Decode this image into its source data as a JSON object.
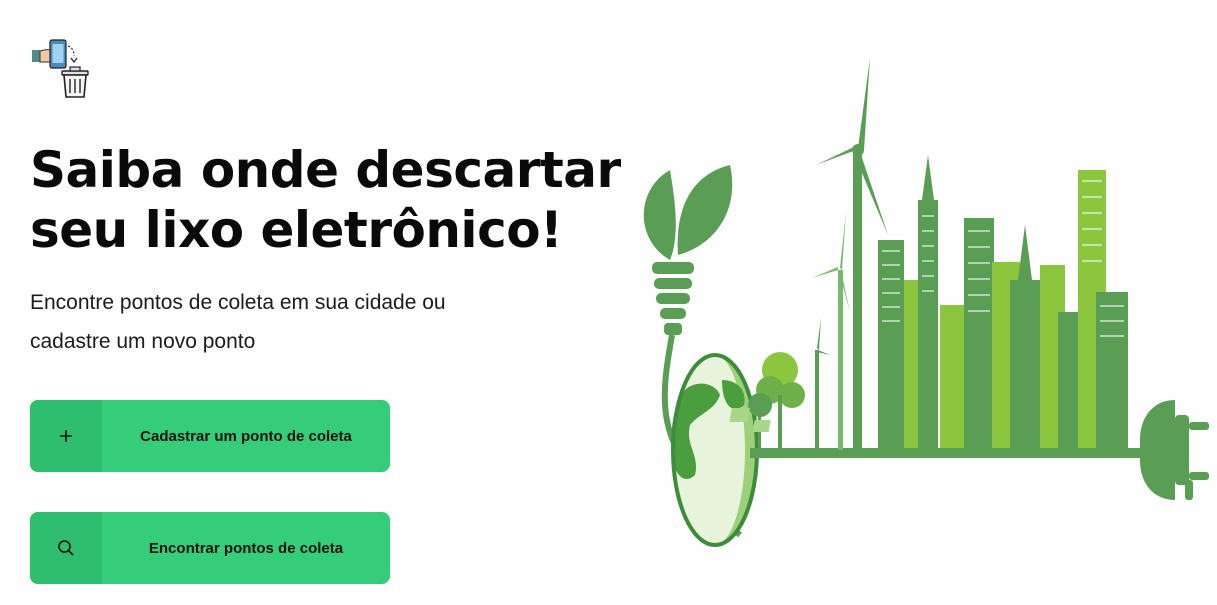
{
  "header": {
    "logo_icon": "recycle-phone-trash-icon"
  },
  "hero": {
    "title_line1": "Saiba onde descartar",
    "title_line2": "seu lixo eletrônico!",
    "subtitle_line1": "Encontre pontos de coleta em sua cidade ou",
    "subtitle_line2": "cadastre um novo ponto"
  },
  "actions": {
    "register": {
      "label": "Cadastrar um ponto de coleta",
      "icon": "plus-icon"
    },
    "find": {
      "label": "Encontrar pontos de coleta",
      "icon": "search-icon"
    }
  },
  "illustration": {
    "icon": "green-city-eco-illustration"
  },
  "colors": {
    "accent": "#35cd79",
    "accent_dark": "#2fbd6f",
    "illustration_green": "#5a9d55",
    "illustration_light": "#8cc63f"
  }
}
